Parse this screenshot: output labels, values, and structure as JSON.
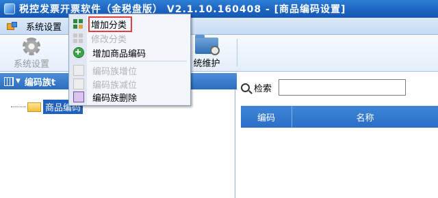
{
  "window": {
    "title": "税控发票开票软件（金税盘版） V2.1.10.160408 - [商品编码设置]"
  },
  "menubar": {
    "items": [
      "系统设置"
    ]
  },
  "toolbar": {
    "settings_label": "系统设置",
    "maintenance_label": "统维护"
  },
  "left_panel": {
    "header_label": "编码族t",
    "tree_root_label": "商品编码"
  },
  "search": {
    "label": "检索",
    "value": ""
  },
  "grid": {
    "columns": [
      "编码",
      "名称"
    ]
  },
  "context_menu": {
    "items": [
      {
        "label": "增加分类",
        "enabled": true,
        "highlighted": true,
        "icon": "category-grid-icon"
      },
      {
        "label": "修改分类",
        "enabled": false,
        "icon": "category-grid-icon"
      },
      {
        "label": "增加商品编码",
        "enabled": true,
        "icon": "plus-circle-icon"
      },
      {
        "label": "编码族增位",
        "enabled": false,
        "icon": "box-icon"
      },
      {
        "label": "编码族减位",
        "enabled": false,
        "icon": "box-icon"
      },
      {
        "label": "编码族删除",
        "enabled": true,
        "icon": "delete-box-icon"
      }
    ]
  },
  "colors": {
    "title_bar": "#1d64c0",
    "header_blue": "#2b6cbf",
    "highlight_box": "#e23c3c",
    "disabled_text": "#b3b3b3"
  }
}
